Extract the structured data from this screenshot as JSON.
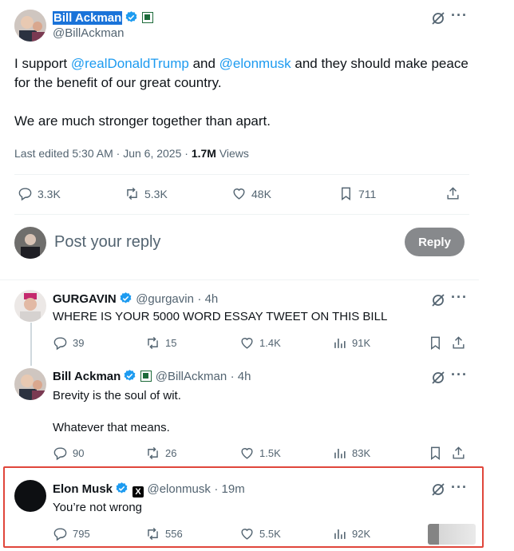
{
  "main_tweet": {
    "name": "Bill Ackman",
    "handle": "@BillAckman",
    "text_prefix": "I support ",
    "mention1": "@realDonaldTrump",
    "text_mid": " and ",
    "mention2": "@elonmusk",
    "text_suffix": " and they should make peace for the benefit of our great country.",
    "text_line2": "We are much stronger together than apart.",
    "meta_time": "Last edited 5:30 AM · Jun 6, 2025 · ",
    "views_count": "1.7M",
    "views_label": " Views",
    "replies": "3.3K",
    "reposts": "5.3K",
    "likes": "48K",
    "bookmarks": "711"
  },
  "reply_box": {
    "placeholder": "Post your reply",
    "button": "Reply"
  },
  "replies": [
    {
      "name": "GURGAVIN",
      "handle": "@gurgavin",
      "time": "· 4h",
      "text": "WHERE IS YOUR 5000 WORD ESSAY TWEET ON THIS BILL",
      "replies": "39",
      "reposts": "15",
      "likes": "1.4K",
      "views": "91K"
    },
    {
      "name": "Bill Ackman",
      "handle": "@BillAckman",
      "time": "· 4h",
      "text1": "Brevity is the soul of wit.",
      "text2": "Whatever that means.",
      "replies": "90",
      "reposts": "26",
      "likes": "1.5K",
      "views": "83K"
    },
    {
      "name": "Elon Musk",
      "handle": "@elonmusk",
      "time": "· 19m",
      "text": "You’re not wrong",
      "replies": "795",
      "reposts": "556",
      "likes": "5.5K",
      "views": "92K"
    }
  ],
  "colors": {
    "accent": "#1d9bf0",
    "highlight_box": "#e0463b",
    "reply_button": "#87898c"
  }
}
